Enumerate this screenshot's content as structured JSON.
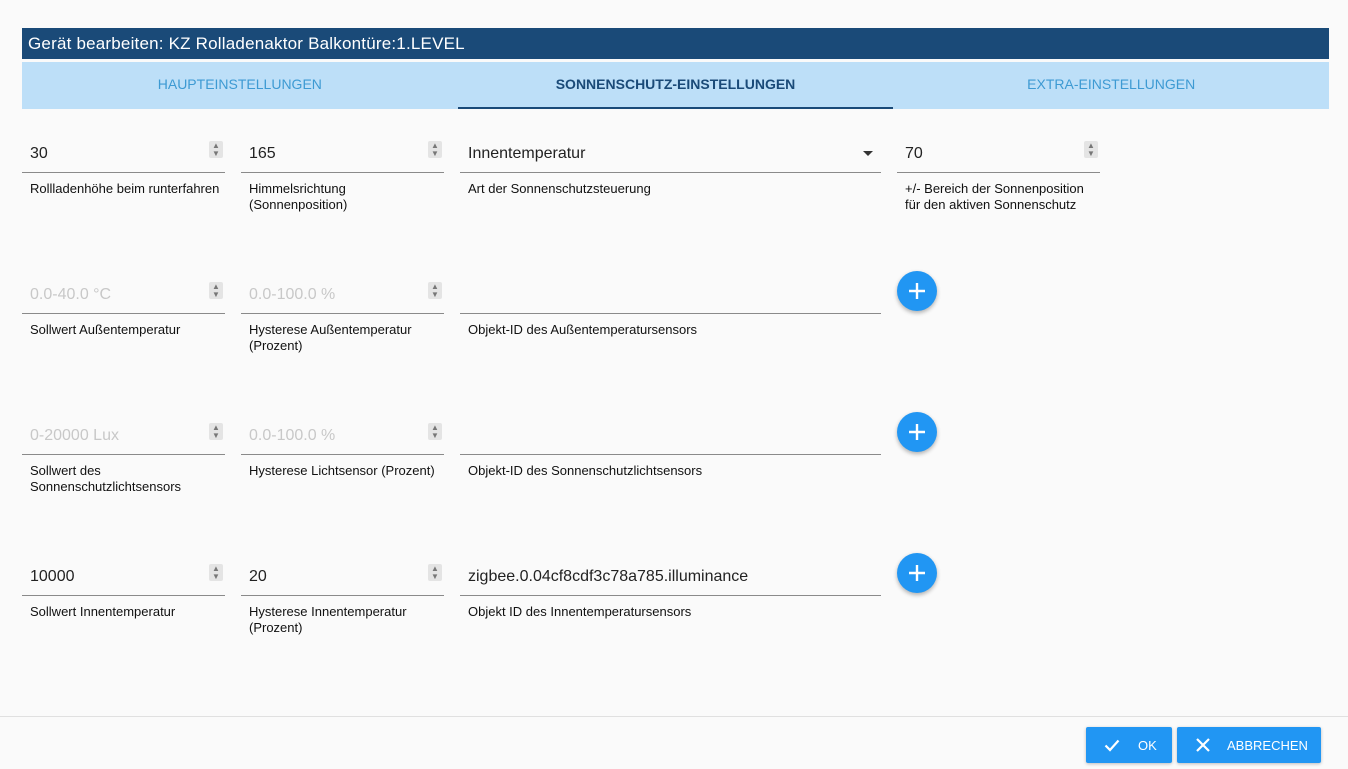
{
  "dialog": {
    "title": "Gerät bearbeiten: KZ Rolladenaktor Balkontüre:1.LEVEL"
  },
  "tabs": [
    {
      "label": "HAUPTEINSTELLUNGEN"
    },
    {
      "label": "SONNENSCHUTZ-EINSTELLUNGEN",
      "active": true
    },
    {
      "label": "EXTRA-EINSTELLUNGEN"
    }
  ],
  "rows": [
    {
      "fields": [
        {
          "value": "30",
          "label": "Rollladenhöhe beim runterfahren"
        },
        {
          "value": "165",
          "label": "Himmelsrichtung (Sonnenposition)"
        },
        {
          "value": "Innentemperatur",
          "label": "Art der Sonnenschutzsteuerung"
        },
        {
          "value": "70",
          "label": "+/- Bereich der Sonnenposition für den aktiven Sonnenschutz"
        }
      ]
    },
    {
      "fields": [
        {
          "placeholder": "0.0-40.0 °C",
          "label": "Sollwert Außentemperatur"
        },
        {
          "placeholder": "0.0-100.0 %",
          "label": "Hysterese Außentemperatur (Prozent)"
        },
        {
          "value": "",
          "label": "Objekt-ID des Außentemperatursensors"
        }
      ]
    },
    {
      "fields": [
        {
          "placeholder": "0-20000 Lux",
          "label": "Sollwert des Sonnenschutzlichtsensors"
        },
        {
          "placeholder": "0.0-100.0 %",
          "label": "Hysterese Lichtsensor (Prozent)"
        },
        {
          "value": "",
          "label": "Objekt-ID des Sonnenschutzlichtsensors"
        }
      ]
    },
    {
      "fields": [
        {
          "value": "10000",
          "label": "Sollwert Innentemperatur"
        },
        {
          "value": "20",
          "label": "Hysterese Innentemperatur (Prozent)"
        },
        {
          "value": "zigbee.0.04cf8cdf3c78a785.illuminance",
          "label": "Objekt ID des Innentemperatursensors"
        }
      ]
    }
  ],
  "footer": {
    "ok_label": "OK",
    "cancel_label": "ABBRECHEN"
  },
  "colors": {
    "title_bar": "#1a4a78",
    "tab_bar": "#bddff8",
    "accent": "#2196f3"
  },
  "icons": {
    "spinner": "spinner-arrows-icon",
    "dropdown": "dropdown-caret-icon",
    "add": "plus-icon",
    "ok": "check-icon",
    "cancel": "close-icon"
  }
}
